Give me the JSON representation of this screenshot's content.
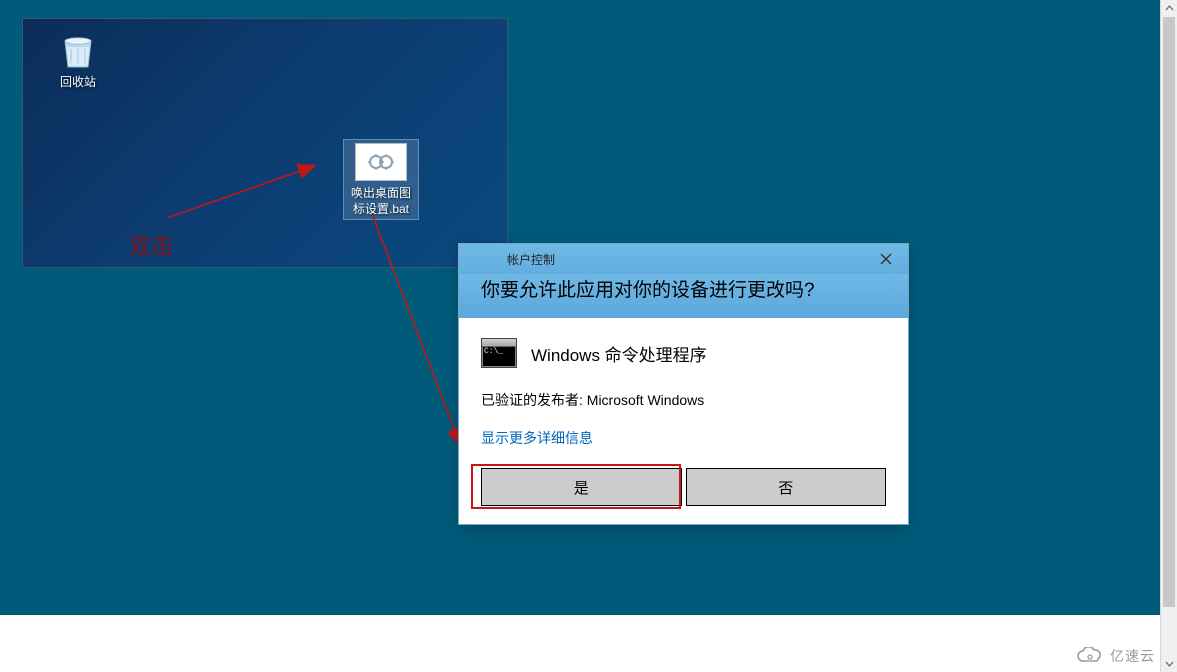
{
  "desktop": {
    "recycle_bin_label": "回收站",
    "bat_file_label": "唤出桌面图标设置.bat",
    "annotation": "双击"
  },
  "uac": {
    "titlebar": "帐户控制",
    "header_question": "你要允许此应用对你的设备进行更改吗?",
    "app_name": "Windows 命令处理程序",
    "publisher_line": "已验证的发布者: Microsoft Windows",
    "details_link": "显示更多详细信息",
    "yes_button": "是",
    "no_button": "否"
  },
  "watermark": {
    "text": "亿速云"
  }
}
